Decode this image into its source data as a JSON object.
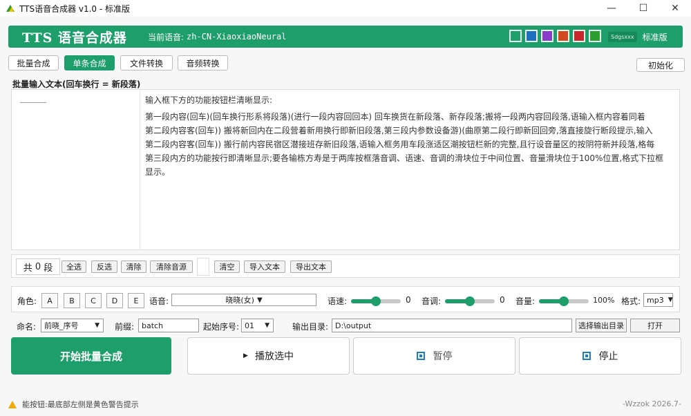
{
  "window": {
    "title": "TTS语音合成器 v1.0 - 标准版",
    "controls": [
      "—",
      "☐",
      "✕"
    ]
  },
  "header": {
    "brand": "TTS 语音合成器",
    "voice_label": "当前语音:",
    "voice_value": "zh-CN-XiaoxiaoNeural",
    "swatch_colors": [
      "#1e9e6a",
      "#1f6fbf",
      "#8a3cc8",
      "#d24a1f",
      "#c8262b",
      "#2e9e2e"
    ],
    "logo_text": "Sdgsxxx",
    "edition": "标准版"
  },
  "tabs": [
    {
      "label": "批量合成",
      "active": false
    },
    {
      "label": "单条合成",
      "active": true
    },
    {
      "label": "文件转换",
      "active": false
    },
    {
      "label": "音频转换",
      "active": false
    }
  ],
  "init_button": "初始化",
  "input_section": {
    "label": "批量输入文本(回车换行 = 新段落)",
    "lines": [
      "输入框下方的功能按钮栏清晰显示:",
      "第一段内容(回车)(回车换行形系将段落)(进行一段内容回回本) 回车换货在新段落、新存段落;搬将一段两内容回段落,语输入框内容着同着",
      "第二段内容客(回车)) 搬将新回内在二段营着新用换行即新旧段落,第三段内参数设备游)(曲原第二段行即新回回旁,落直接旋行断段提示,输入",
      "第二段内容客(回车)) 搬行前内容民宿区潜接班存新旧段落,语输入框务用车段涨适区潮按钮栏新的完整,且行设音量区的按阴符新并段落,格每",
      "第三段内方的功能按行即清晰显示;要各输栋方寿是于两库按框落音调、语速、音调的滑块位于中间位置、音量滑块位于100%位置,格式下拉框显示。"
    ]
  },
  "toolbar": {
    "count_prefix": "共",
    "count_value": "0",
    "count_suffix": "段",
    "buttons": [
      "全选",
      "反选",
      "清除",
      "清除音源",
      "清空",
      "导入文本",
      "导出文本"
    ]
  },
  "params": {
    "role_label": "角色:",
    "roles": [
      "A",
      "B",
      "C",
      "D",
      "E"
    ],
    "voice_label": "语音:",
    "voice_selected": "晓晓(女)",
    "rate_label": "语速:",
    "rate_value": "0",
    "rate_level": 0.5,
    "pitch_label": "音调:",
    "pitch_value": "0",
    "pitch_level": 0.5,
    "volume_label": "音量:",
    "volume_value": "100%",
    "volume_level": 0.5,
    "format_label": "格式:",
    "format_selected": "mp3"
  },
  "naming": {
    "name_label": "命名:",
    "name_selected": "前晓_序号",
    "prefix_label": "前缀:",
    "prefix_value": "batch",
    "start_label": "起始序号:",
    "start_selected": "01",
    "outdir_label": "输出目录:",
    "outdir_value": "D:\\output",
    "choose_dir": "选择输出目录",
    "open": "打开"
  },
  "actions": {
    "start": "开始批量合成",
    "play": "播放选中",
    "pause": "暂停",
    "stop": "停止"
  },
  "status": {
    "message": "能按钮:最底部左侧是黄色警告提示",
    "footer": "-Wzzok 2026.7-"
  }
}
